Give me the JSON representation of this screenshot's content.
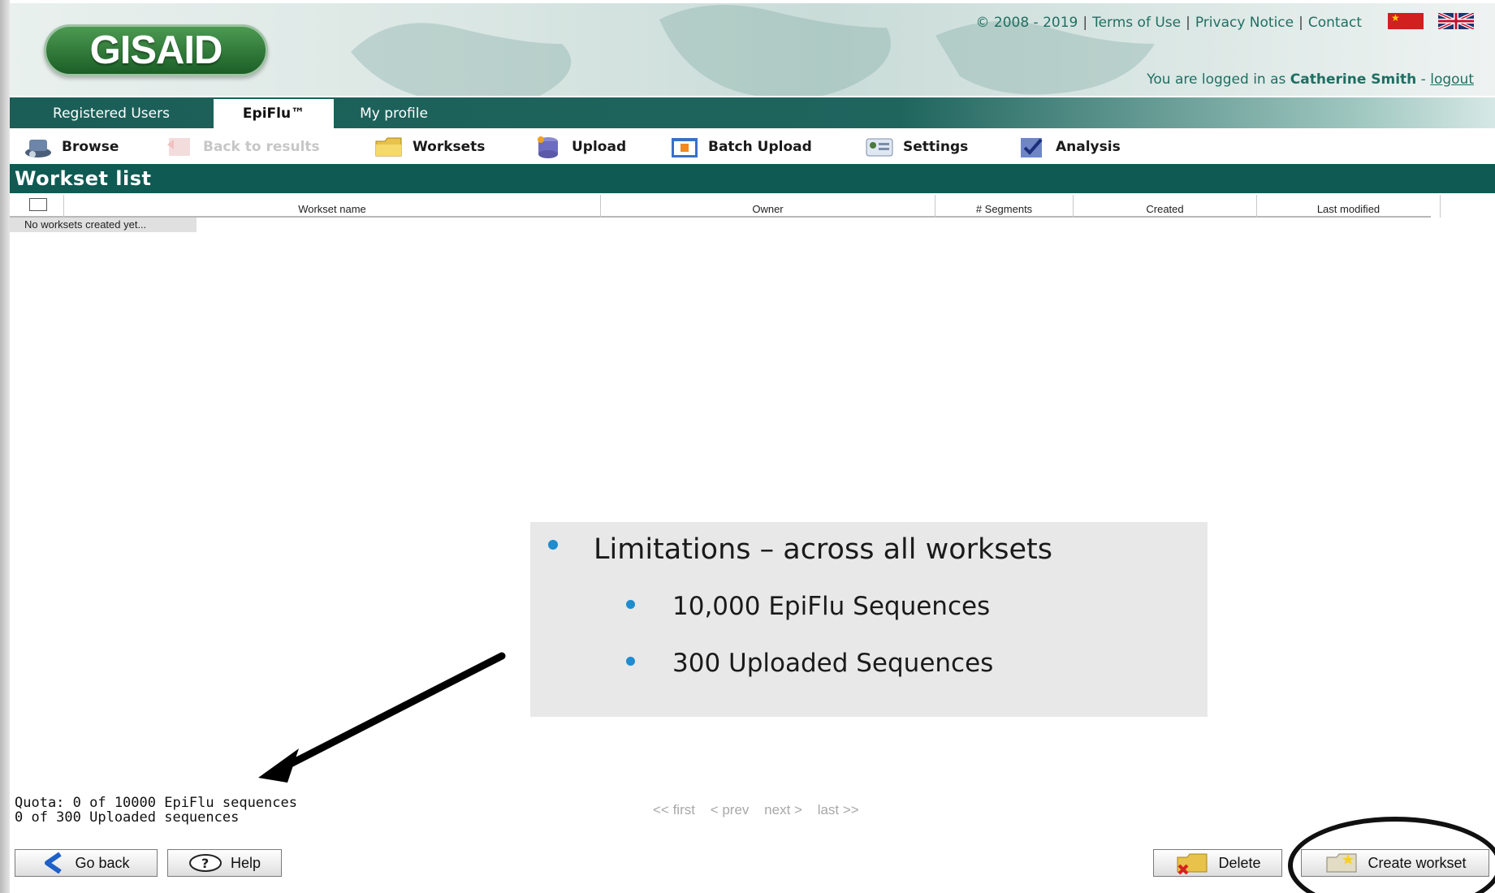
{
  "header": {
    "logo": "GISAID",
    "copyright": "© 2008 - 2019",
    "links": [
      "Terms of Use",
      "Privacy Notice",
      "Contact"
    ],
    "logged_in_prefix": "You are logged in as",
    "user_name": "Catherine Smith",
    "logout_label": "logout"
  },
  "tabs": [
    "Registered Users",
    "EpiFlu™",
    "My profile"
  ],
  "active_tab": "EpiFlu™",
  "toolbar": {
    "browse": "Browse",
    "back_to_results": "Back to results",
    "worksets": "Worksets",
    "upload": "Upload",
    "batch_upload": "Batch Upload",
    "settings": "Settings",
    "analysis": "Analysis"
  },
  "workset_list": {
    "title": "Workset list",
    "columns": [
      "Workset name",
      "Owner",
      "# Segments",
      "Created",
      "Last modified"
    ],
    "empty_message": "No worksets created yet..."
  },
  "callout": {
    "main": "Limitations – across all worksets",
    "items": [
      "10,000 EpiFlu Sequences",
      "300 Uploaded Sequences"
    ]
  },
  "quota": {
    "line1": "Quota: 0 of 10000 EpiFlu sequences",
    "line2": "0 of 300 Uploaded sequences"
  },
  "pager": {
    "first": "<< first",
    "prev": "< prev",
    "next": "next >",
    "last": "last >>"
  },
  "buttons": {
    "go_back": "Go back",
    "help": "Help",
    "delete": "Delete",
    "create_workset": "Create workset"
  },
  "colors": {
    "brand_green": "#0f5a52",
    "link_teal": "#1f6f62",
    "bullet_blue": "#1e8ccf"
  }
}
